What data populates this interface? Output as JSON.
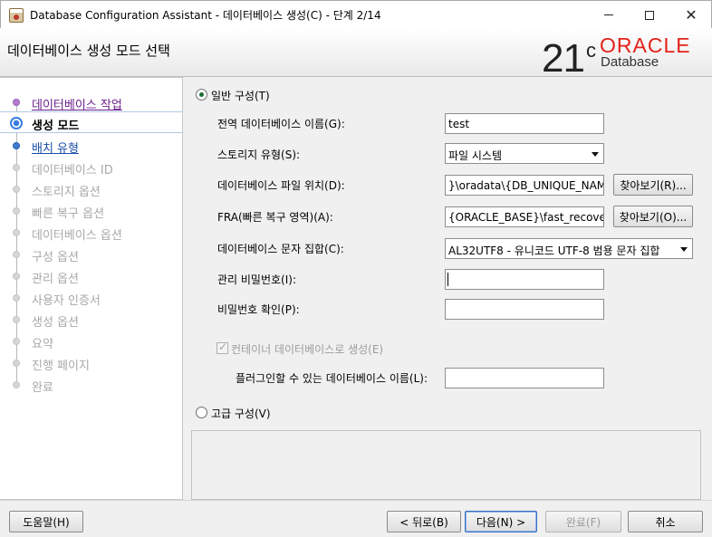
{
  "window": {
    "title": "Database Configuration Assistant - 데이터베이스 생성(C) - 단계 2/14"
  },
  "header": {
    "title": "데이터베이스 생성 모드 선택",
    "logo_version": "21",
    "logo_superscript": "c",
    "logo_brand": "ORACLE",
    "logo_product": "Database"
  },
  "nav": {
    "items": [
      {
        "label": "데이터베이스 작업",
        "state": "done"
      },
      {
        "label": "생성 모드",
        "state": "current"
      },
      {
        "label": "배치 유형",
        "state": "link"
      },
      {
        "label": "데이터베이스 ID",
        "state": "disabled"
      },
      {
        "label": "스토리지 옵션",
        "state": "disabled"
      },
      {
        "label": "빠른 복구 옵션",
        "state": "disabled"
      },
      {
        "label": "데이터베이스 옵션",
        "state": "disabled"
      },
      {
        "label": "구성 옵션",
        "state": "disabled"
      },
      {
        "label": "관리 옵션",
        "state": "disabled"
      },
      {
        "label": "사용자 인증서",
        "state": "disabled"
      },
      {
        "label": "생성 옵션",
        "state": "disabled"
      },
      {
        "label": "요약",
        "state": "disabled"
      },
      {
        "label": "진행 페이지",
        "state": "disabled"
      },
      {
        "label": "완료",
        "state": "disabled"
      }
    ]
  },
  "form": {
    "typical_label": "일반 구성(T)",
    "typical_selected": true,
    "global_db_name_label": "전역 데이터베이스 이름(G):",
    "global_db_name_value": "test",
    "storage_type_label": "스토리지 유형(S):",
    "storage_type_value": "파일 시스템",
    "file_location_label": "데이터베이스 파일 위치(D):",
    "file_location_value": "}\\oradata\\{DB_UNIQUE_NAME}",
    "fra_label": "FRA(빠른 복구 영역)(A):",
    "fra_value": "{ORACLE_BASE}\\fast_recovery_",
    "browse_label_1": "찾아보기(R)...",
    "browse_label_2": "찾아보기(O)...",
    "charset_label": "데이터베이스 문자 집합(C):",
    "charset_value": "AL32UTF8 - 유니코드 UTF-8 범용 문자 집합",
    "admin_password_label": "관리 비밀번호(I):",
    "admin_password_value": "",
    "confirm_password_label": "비밀번호 확인(P):",
    "confirm_password_value": "",
    "container_db_label": "컨테이너 데이터베이스로 생성(E)",
    "container_db_checked": true,
    "pdb_name_label": "플러그인할 수 있는 데이터베이스 이름(L):",
    "pdb_name_value": "",
    "advanced_label": "고급 구성(V)",
    "advanced_selected": false
  },
  "footer": {
    "help_label": "도움말(H)",
    "back_label": "< 뒤로(B)",
    "next_label": "다음(N) >",
    "finish_label": "완료(F)",
    "cancel_label": "취소"
  }
}
